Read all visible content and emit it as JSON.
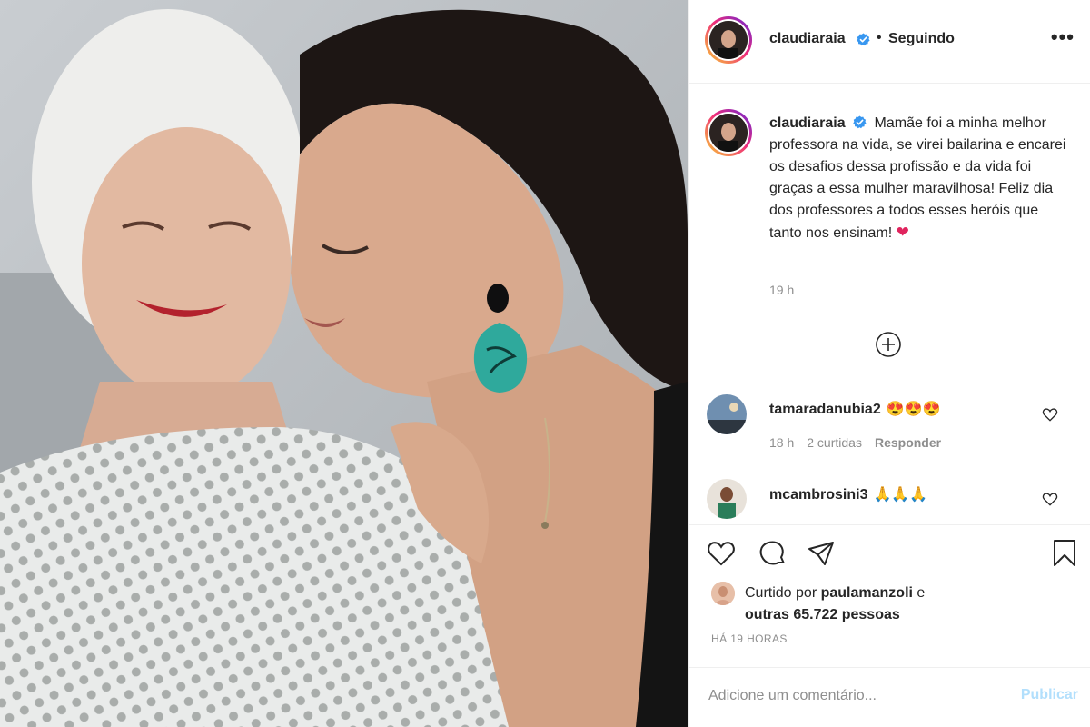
{
  "post": {
    "author": "claudiaraia",
    "verified": true,
    "follow_status": "Seguindo",
    "follow_separator": "•",
    "more_label": "•••"
  },
  "caption": {
    "username": "claudiaraia",
    "text": "Mamãe foi a minha melhor professora na vida, se virei bailarina e encarei os desafios dessa profissão e da vida foi graças a essa mulher maravilhosa! Feliz dia dos professores a todos esses heróis que tanto nos ensinam!",
    "emoji": "❤",
    "time": "19 h"
  },
  "comments": [
    {
      "username": "tamaradanubia2",
      "text": "😍😍😍",
      "time": "18 h",
      "likes": "2 curtidas",
      "reply_label": "Responder"
    },
    {
      "username": "mcambrosini3",
      "text": "🙏🙏🙏"
    }
  ],
  "likes": {
    "prefix": "Curtido por",
    "user": "paulamanzoli",
    "conjunction": "e",
    "others": "outras 65.722 pessoas"
  },
  "posted_ago": "HÁ 19 HORAS",
  "comment_box": {
    "placeholder": "Adicione um comentário...",
    "publish_label": "Publicar"
  },
  "colors": {
    "accent_blue_disabled": "#b2dffc",
    "verified_blue": "#3897f0",
    "secondary_text": "#8e8e8e",
    "divider": "#efefef"
  },
  "icons": [
    "heart-icon",
    "comment-icon",
    "share-icon",
    "bookmark-icon",
    "plus-circle-icon",
    "verified-badge-icon",
    "more-options-icon"
  ]
}
